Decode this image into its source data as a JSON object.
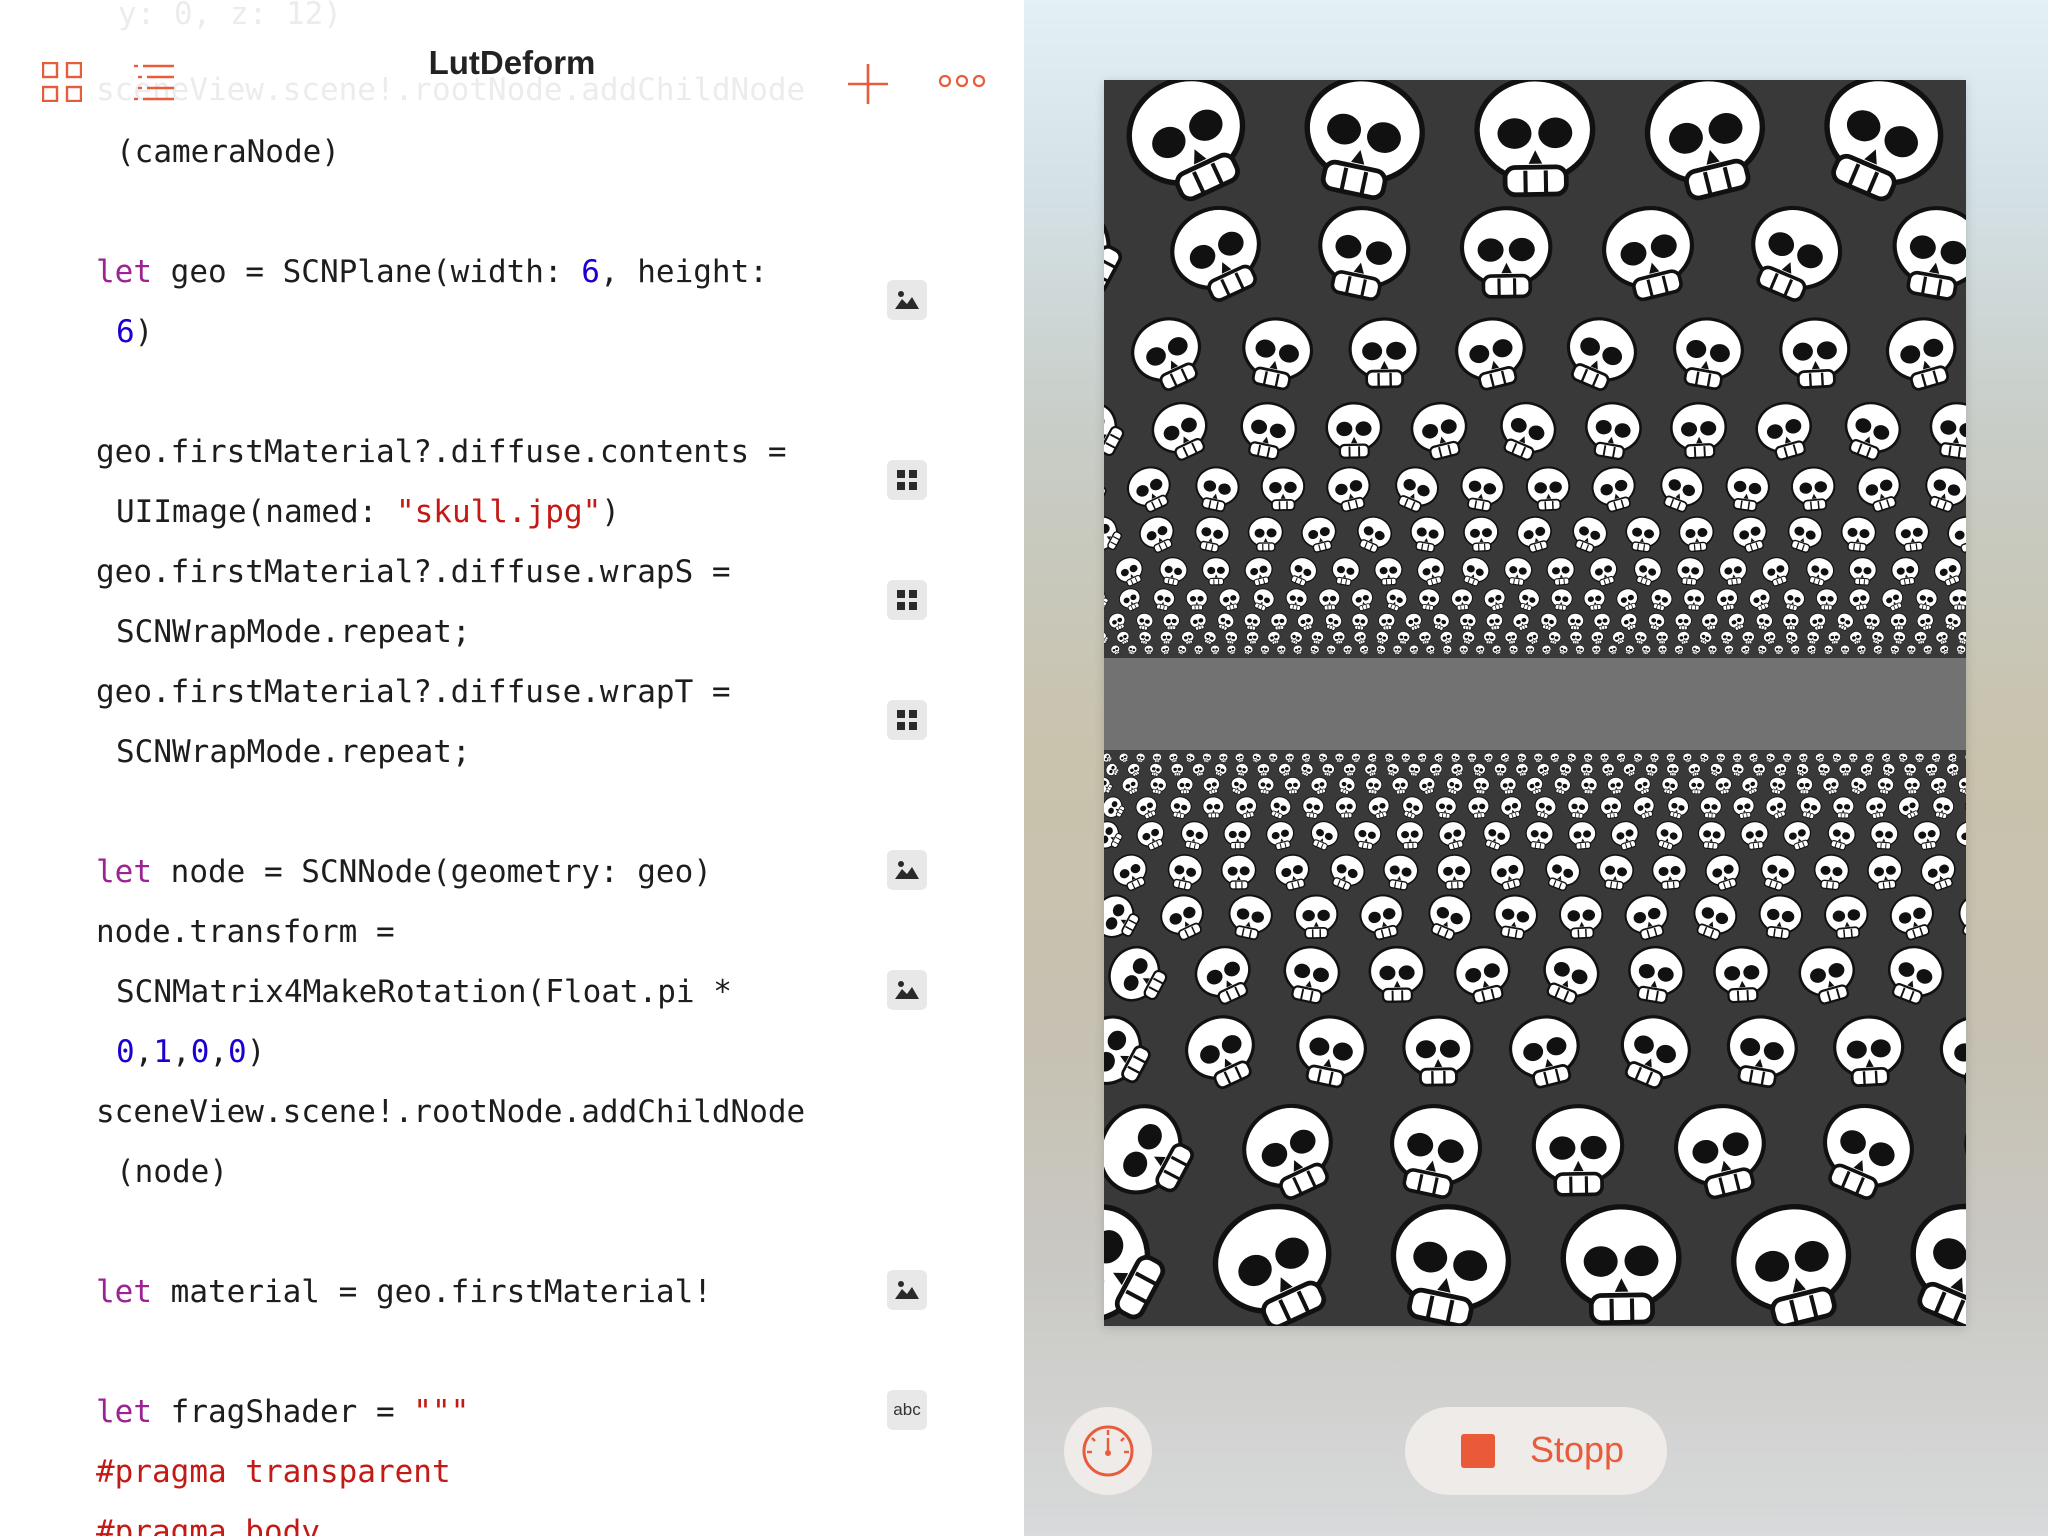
{
  "app": {
    "title": "LutDeform"
  },
  "toolbar": {
    "icons": [
      "grid-icon",
      "list-icon",
      "plus-icon",
      "more-icon"
    ],
    "accent_color": "#e85c3c"
  },
  "editor": {
    "ghost_lines": [
      "y: 0, z: 12)",
      "sceneView.scene!.rootNode.addChildNode"
    ],
    "lines": [
      "(cameraNode)",
      "let",
      " geo = SCNPlane(width: ",
      "6",
      ", height:",
      "6",
      ")",
      "geo.firstMaterial?.diffuse.contents =",
      "UIImage(named: ",
      "\"skull.jpg\"",
      ")",
      "geo.firstMaterial?.diffuse.wrapS =",
      "SCNWrapMode.repeat;",
      "geo.firstMaterial?.diffuse.wrapT =",
      "SCNWrapMode.repeat;",
      "let",
      " node = SCNNode(geometry: geo)",
      "node.transform =",
      "SCNMatrix4MakeRotation(Float.pi *",
      "0",
      ",",
      "1",
      ",",
      "0",
      ",",
      "0",
      ")",
      "sceneView.scene!.rootNode.addChildNode",
      "(node)",
      "let",
      " material = geo.firstMaterial!",
      "let",
      " fragShader = ",
      "\"\"\"",
      "#pragma transparent",
      "#pragma body"
    ],
    "gutter_icons": [
      "image-icon",
      "grid-icon",
      "grid-icon",
      "grid-icon",
      "image-icon",
      "image-icon",
      "image-icon",
      "abc"
    ],
    "colors": {
      "keyword": "#9b2393",
      "number": "#1c00cf",
      "string": "#c41a16"
    }
  },
  "preview": {
    "scene_icon": "skull-pattern",
    "controls": {
      "stop_label": "Stopp",
      "gauge_icon": "speedometer-icon"
    }
  }
}
